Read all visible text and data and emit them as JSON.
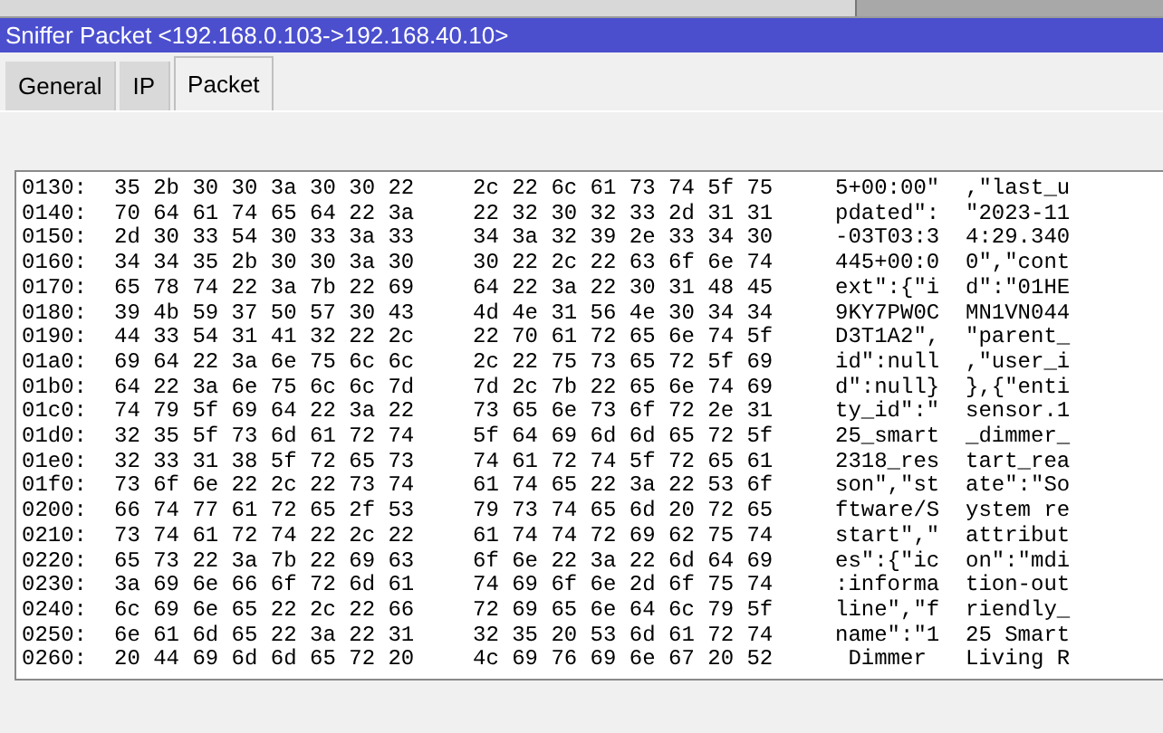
{
  "window": {
    "title": "Sniffer Packet <192.168.0.103->192.168.40.10>"
  },
  "tabs": [
    {
      "label": "General",
      "selected": false
    },
    {
      "label": "IP",
      "selected": false
    },
    {
      "label": "Packet",
      "selected": true
    }
  ],
  "dump": [
    {
      "offset": "0130:",
      "hex": [
        "35 2b 30 30 3a 30 30 22",
        "2c 22 6c 61 73 74 5f 75"
      ],
      "ascii": [
        "5+00:00\"",
        ",\"last_u"
      ]
    },
    {
      "offset": "0140:",
      "hex": [
        "70 64 61 74 65 64 22 3a",
        "22 32 30 32 33 2d 31 31"
      ],
      "ascii": [
        "pdated\":",
        "\"2023-11"
      ]
    },
    {
      "offset": "0150:",
      "hex": [
        "2d 30 33 54 30 33 3a 33",
        "34 3a 32 39 2e 33 34 30"
      ],
      "ascii": [
        "-03T03:3",
        "4:29.340"
      ]
    },
    {
      "offset": "0160:",
      "hex": [
        "34 34 35 2b 30 30 3a 30",
        "30 22 2c 22 63 6f 6e 74"
      ],
      "ascii": [
        "445+00:0",
        "0\",\"cont"
      ]
    },
    {
      "offset": "0170:",
      "hex": [
        "65 78 74 22 3a 7b 22 69",
        "64 22 3a 22 30 31 48 45"
      ],
      "ascii": [
        "ext\":{\"i",
        "d\":\"01HE"
      ]
    },
    {
      "offset": "0180:",
      "hex": [
        "39 4b 59 37 50 57 30 43",
        "4d 4e 31 56 4e 30 34 34"
      ],
      "ascii": [
        "9KY7PW0C",
        "MN1VN044"
      ]
    },
    {
      "offset": "0190:",
      "hex": [
        "44 33 54 31 41 32 22 2c",
        "22 70 61 72 65 6e 74 5f"
      ],
      "ascii": [
        "D3T1A2\",",
        "\"parent_"
      ]
    },
    {
      "offset": "01a0:",
      "hex": [
        "69 64 22 3a 6e 75 6c 6c",
        "2c 22 75 73 65 72 5f 69"
      ],
      "ascii": [
        "id\":null",
        ",\"user_i"
      ]
    },
    {
      "offset": "01b0:",
      "hex": [
        "64 22 3a 6e 75 6c 6c 7d",
        "7d 2c 7b 22 65 6e 74 69"
      ],
      "ascii": [
        "d\":null}",
        "},{\"enti"
      ]
    },
    {
      "offset": "01c0:",
      "hex": [
        "74 79 5f 69 64 22 3a 22",
        "73 65 6e 73 6f 72 2e 31"
      ],
      "ascii": [
        "ty_id\":\"",
        "sensor.1"
      ]
    },
    {
      "offset": "01d0:",
      "hex": [
        "32 35 5f 73 6d 61 72 74",
        "5f 64 69 6d 6d 65 72 5f"
      ],
      "ascii": [
        "25_smart",
        "_dimmer_"
      ]
    },
    {
      "offset": "01e0:",
      "hex": [
        "32 33 31 38 5f 72 65 73",
        "74 61 72 74 5f 72 65 61"
      ],
      "ascii": [
        "2318_res",
        "tart_rea"
      ]
    },
    {
      "offset": "01f0:",
      "hex": [
        "73 6f 6e 22 2c 22 73 74",
        "61 74 65 22 3a 22 53 6f"
      ],
      "ascii": [
        "son\",\"st",
        "ate\":\"So"
      ]
    },
    {
      "offset": "0200:",
      "hex": [
        "66 74 77 61 72 65 2f 53",
        "79 73 74 65 6d 20 72 65"
      ],
      "ascii": [
        "ftware/S",
        "ystem re"
      ]
    },
    {
      "offset": "0210:",
      "hex": [
        "73 74 61 72 74 22 2c 22",
        "61 74 74 72 69 62 75 74"
      ],
      "ascii": [
        "start\",\"",
        "attribut"
      ]
    },
    {
      "offset": "0220:",
      "hex": [
        "65 73 22 3a 7b 22 69 63",
        "6f 6e 22 3a 22 6d 64 69"
      ],
      "ascii": [
        "es\":{\"ic",
        "on\":\"mdi"
      ]
    },
    {
      "offset": "0230:",
      "hex": [
        "3a 69 6e 66 6f 72 6d 61",
        "74 69 6f 6e 2d 6f 75 74"
      ],
      "ascii": [
        ":informa",
        "tion-out"
      ]
    },
    {
      "offset": "0240:",
      "hex": [
        "6c 69 6e 65 22 2c 22 66",
        "72 69 65 6e 64 6c 79 5f"
      ],
      "ascii": [
        "line\",\"f",
        "riendly_"
      ]
    },
    {
      "offset": "0250:",
      "hex": [
        "6e 61 6d 65 22 3a 22 31",
        "32 35 20 53 6d 61 72 74"
      ],
      "ascii": [
        "name\":\"1",
        "25 Smart"
      ]
    },
    {
      "offset": "0260:",
      "hex": [
        "20 44 69 6d 6d 65 72 20",
        "4c 69 76 69 6e 67 20 52"
      ],
      "ascii": [
        " Dimmer ",
        "Living R"
      ]
    }
  ]
}
